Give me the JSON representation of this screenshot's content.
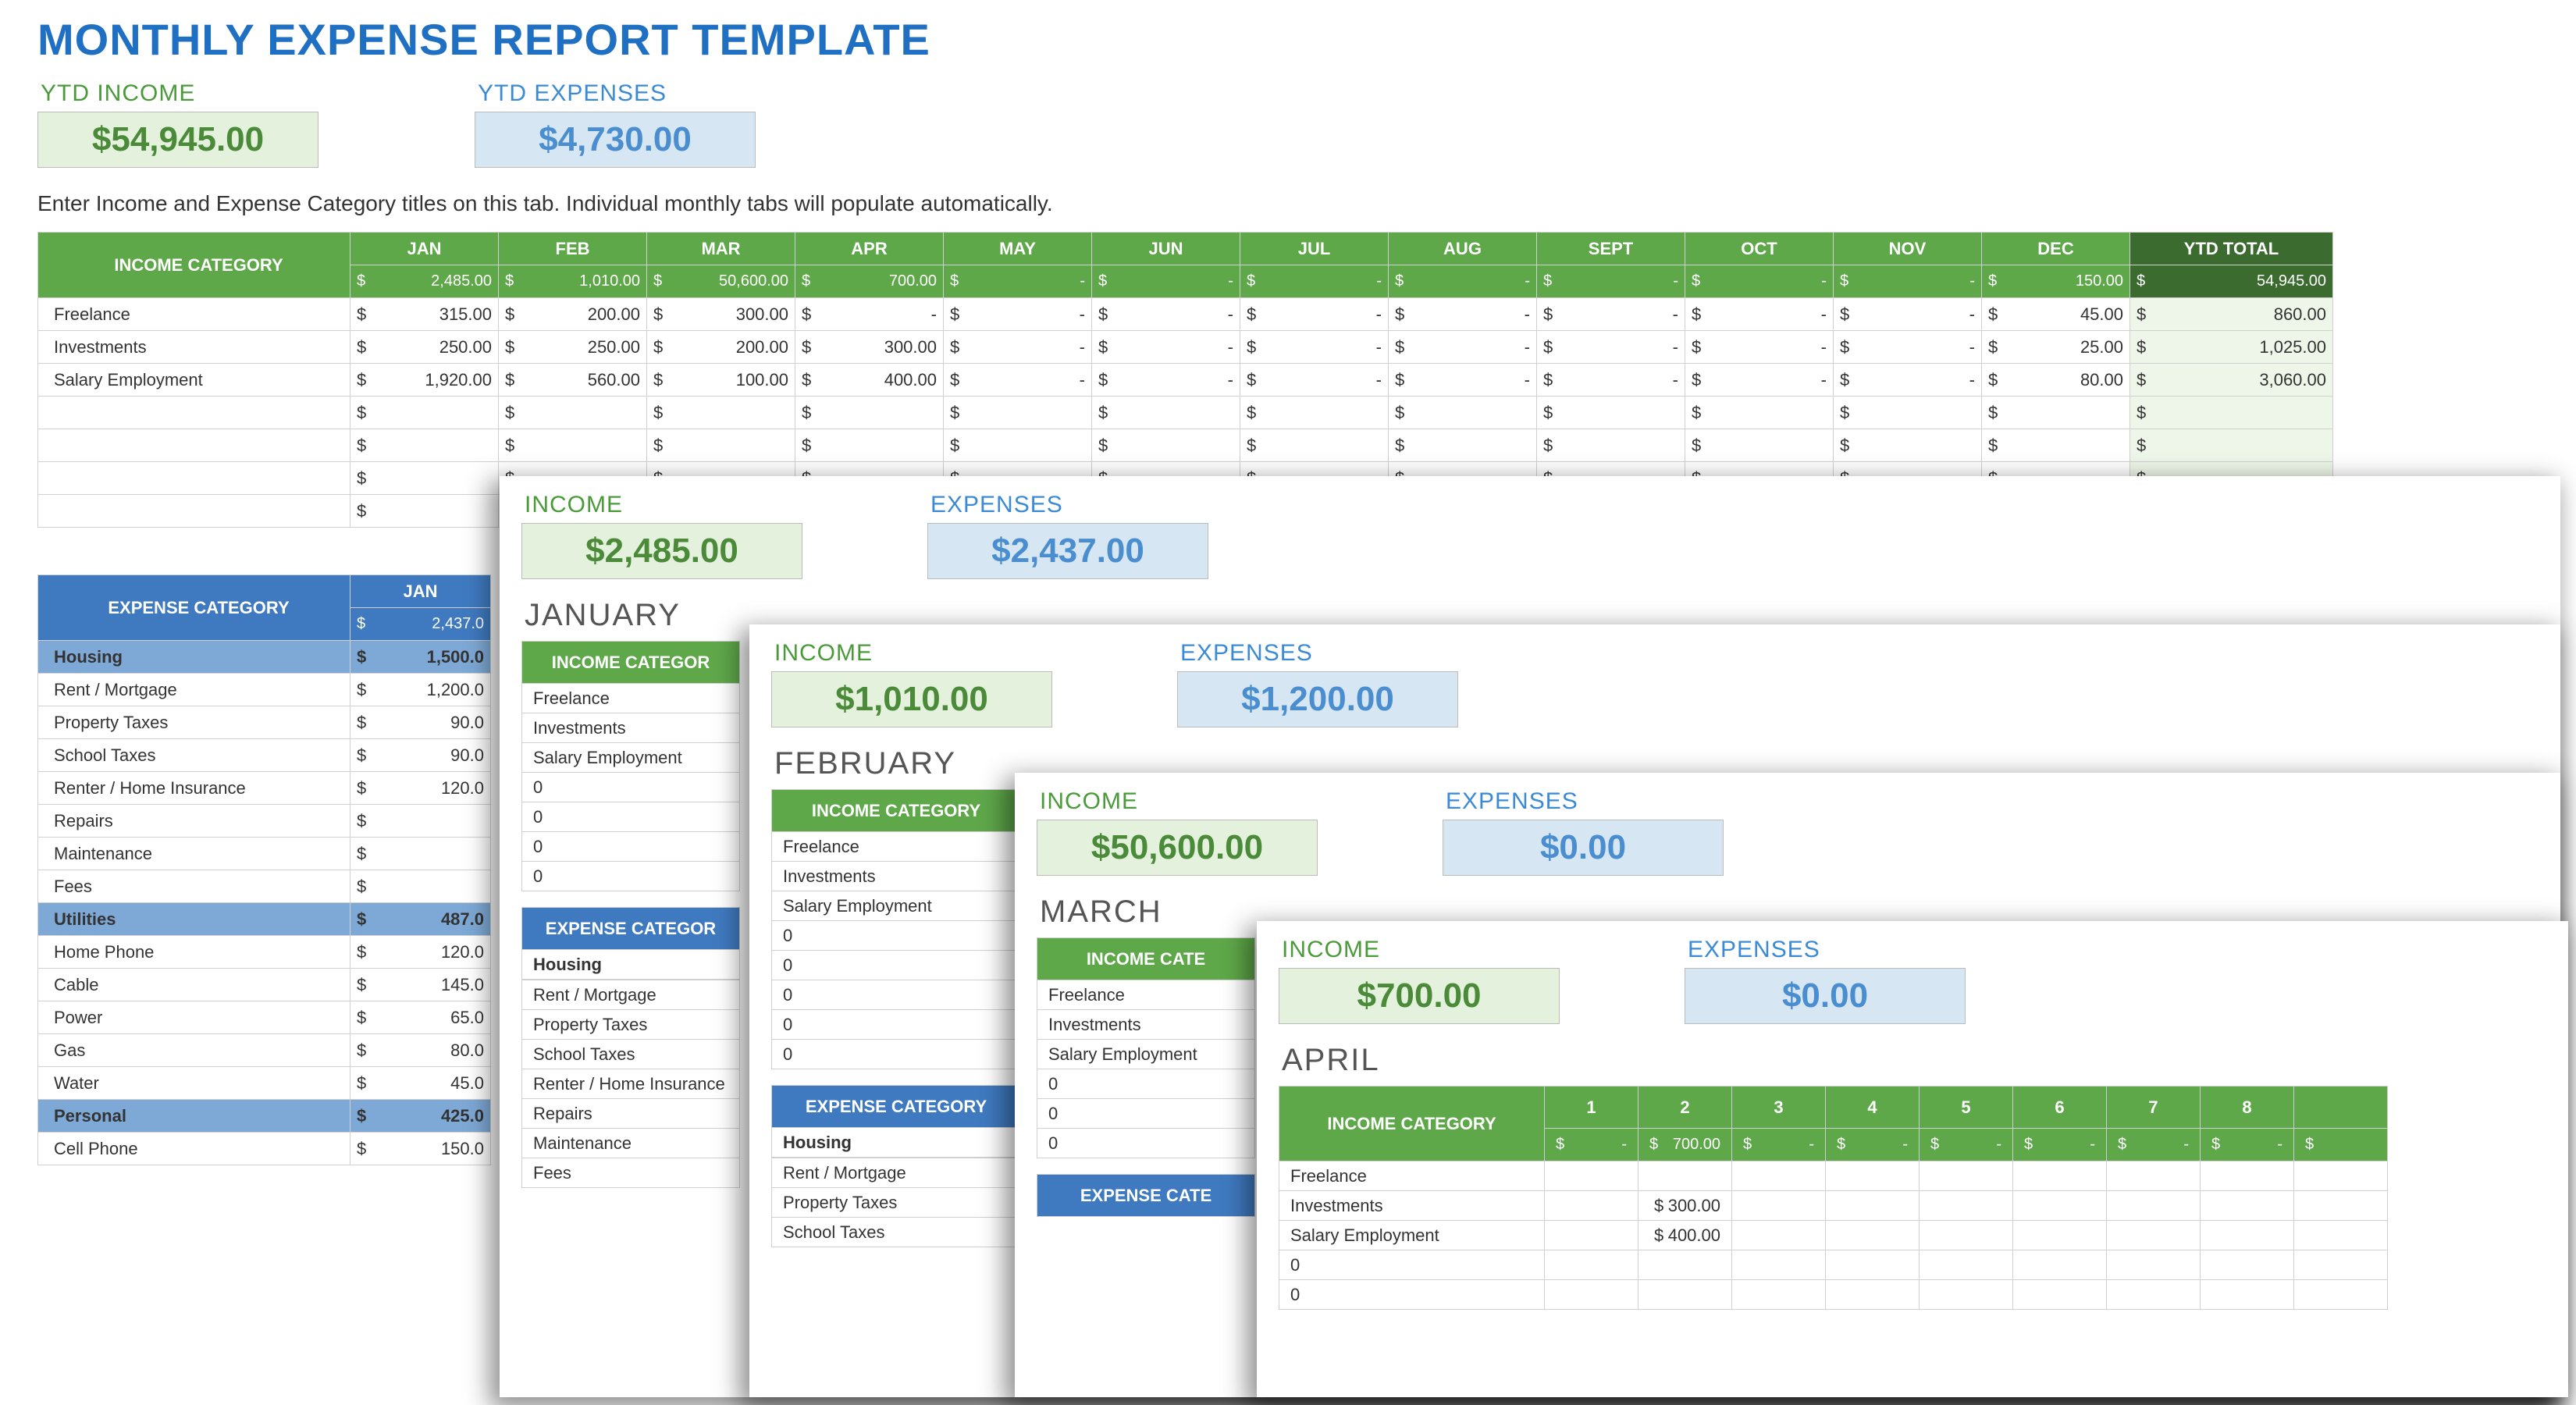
{
  "title": "MONTHLY EXPENSE REPORT TEMPLATE",
  "ytd_income_label": "YTD INCOME",
  "ytd_income_value": "$54,945.00",
  "ytd_expenses_label": "YTD EXPENSES",
  "ytd_expenses_value": "$4,730.00",
  "hint": "Enter Income and Expense Category titles on this tab.  Individual monthly tabs will populate automatically.",
  "months": [
    "JAN",
    "FEB",
    "MAR",
    "APR",
    "MAY",
    "JUN",
    "JUL",
    "AUG",
    "SEPT",
    "OCT",
    "NOV",
    "DEC"
  ],
  "ytd_total_label": "YTD TOTAL",
  "income_header": "INCOME CATEGORY",
  "income_totals_row": [
    "2,485.00",
    "1,010.00",
    "50,600.00",
    "700.00",
    "-",
    "-",
    "-",
    "-",
    "-",
    "-",
    "-",
    "150.00",
    "54,945.00"
  ],
  "income_rows": [
    {
      "name": "Freelance",
      "vals": [
        "315.00",
        "200.00",
        "300.00",
        "-",
        "-",
        "-",
        "-",
        "-",
        "-",
        "-",
        "-",
        "45.00"
      ],
      "ytd": "860.00"
    },
    {
      "name": "Investments",
      "vals": [
        "250.00",
        "250.00",
        "200.00",
        "300.00",
        "-",
        "-",
        "-",
        "-",
        "-",
        "-",
        "-",
        "25.00"
      ],
      "ytd": "1,025.00"
    },
    {
      "name": "Salary Employment",
      "vals": [
        "1,920.00",
        "560.00",
        "100.00",
        "400.00",
        "-",
        "-",
        "-",
        "-",
        "-",
        "-",
        "-",
        "80.00"
      ],
      "ytd": "3,060.00"
    }
  ],
  "expense_header": "EXPENSE CATEGORY",
  "exp_jan_label": "JAN",
  "exp_jan_total": "2,437.0",
  "expense_rows": [
    {
      "name": "Housing",
      "val": "1,500.0",
      "band": true
    },
    {
      "name": "Rent / Mortgage",
      "val": "1,200.0"
    },
    {
      "name": "Property Taxes",
      "val": "90.0"
    },
    {
      "name": "School Taxes",
      "val": "90.0"
    },
    {
      "name": "Renter / Home Insurance",
      "val": "120.0"
    },
    {
      "name": "Repairs",
      "val": ""
    },
    {
      "name": "Maintenance",
      "val": ""
    },
    {
      "name": "Fees",
      "val": ""
    },
    {
      "name": "Utilities",
      "val": "487.0",
      "band": true
    },
    {
      "name": "Home Phone",
      "val": "120.0"
    },
    {
      "name": "Cable",
      "val": "145.0"
    },
    {
      "name": "Power",
      "val": "65.0"
    },
    {
      "name": "Gas",
      "val": "80.0"
    },
    {
      "name": "Water",
      "val": "45.0"
    },
    {
      "name": "Personal",
      "val": "425.0",
      "band": true
    },
    {
      "name": "Cell Phone",
      "val": "150.0"
    }
  ],
  "card_jan": {
    "income_label": "INCOME",
    "income_value": "$2,485.00",
    "exp_label": "EXPENSES",
    "exp_value": "$2,437.00",
    "month": "JANUARY",
    "income_cat": "INCOME CATEGOR",
    "rows": [
      "Freelance",
      "Investments",
      "Salary Employment",
      "0",
      "0",
      "0",
      "0"
    ],
    "exp_cat": "EXPENSE CATEGOR",
    "housing": "Housing",
    "exp_rows": [
      "Rent / Mortgage",
      "Property Taxes",
      "School Taxes",
      "Renter / Home Insurance",
      "Repairs",
      "Maintenance",
      "Fees"
    ]
  },
  "card_feb": {
    "income_label": "INCOME",
    "income_value": "$1,010.00",
    "exp_label": "EXPENSES",
    "exp_value": "$1,200.00",
    "month": "FEBRUARY",
    "income_cat": "INCOME CATEGORY",
    "rows": [
      "Freelance",
      "Investments",
      "Salary Employment",
      "0",
      "0",
      "0",
      "0",
      "0"
    ],
    "exp_cat": "EXPENSE CATEGORY",
    "housing": "Housing",
    "exp_rows": [
      "Rent / Mortgage",
      "Property Taxes",
      "School Taxes"
    ]
  },
  "card_mar": {
    "income_label": "INCOME",
    "income_value": "$50,600.00",
    "exp_label": "EXPENSES",
    "exp_value": "$0.00",
    "month": "MARCH",
    "income_cat": "INCOME CATE",
    "rows": [
      "Freelance",
      "Investments",
      "Salary Employment",
      "0",
      "0",
      "0"
    ],
    "exp_cat": "EXPENSE CATE"
  },
  "card_apr": {
    "income_label": "INCOME",
    "income_value": "$700.00",
    "exp_label": "EXPENSES",
    "exp_value": "$0.00",
    "month": "APRIL",
    "income_cat": "INCOME CATEGORY",
    "days": [
      "1",
      "2",
      "3",
      "4",
      "5",
      "6",
      "7",
      "8"
    ],
    "day_totals": [
      "-",
      "700.00",
      "-",
      "-",
      "-",
      "-",
      "-",
      "-"
    ],
    "rows": [
      {
        "name": "Freelance",
        "vals": [
          "",
          "",
          "",
          "",
          "",
          "",
          "",
          ""
        ]
      },
      {
        "name": "Investments",
        "vals": [
          "",
          "300.00",
          "",
          "",
          "",
          "",
          "",
          ""
        ]
      },
      {
        "name": "Salary Employment",
        "vals": [
          "",
          "400.00",
          "",
          "",
          "",
          "",
          "",
          ""
        ]
      },
      {
        "name": "0",
        "vals": [
          "",
          "",
          "",
          "",
          "",
          "",
          "",
          ""
        ]
      },
      {
        "name": "0",
        "vals": [
          "",
          "",
          "",
          "",
          "",
          "",
          "",
          ""
        ]
      }
    ]
  }
}
